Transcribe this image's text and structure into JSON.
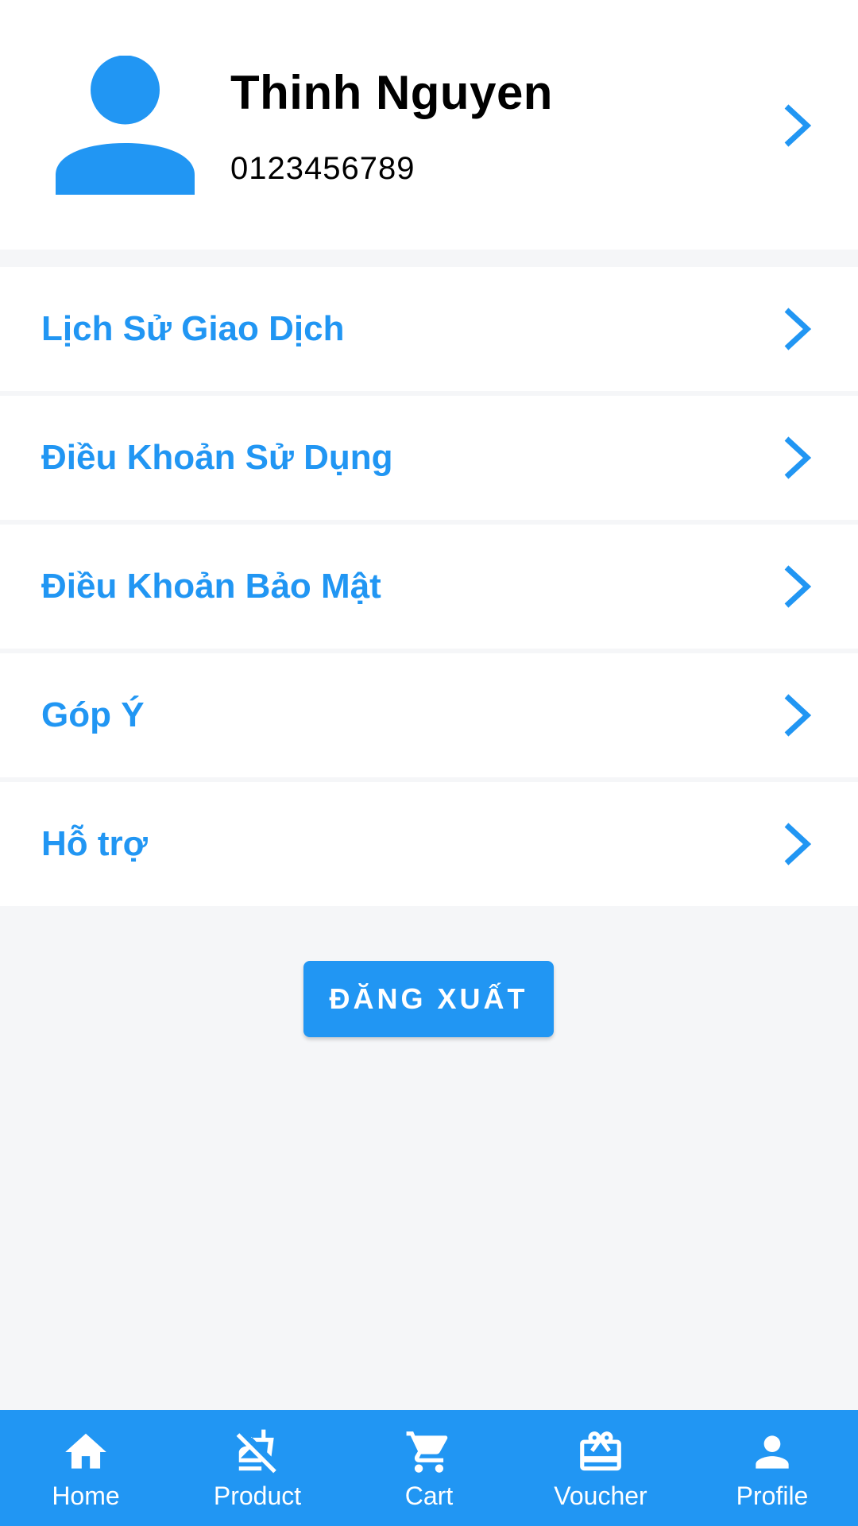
{
  "colors": {
    "accent": "#2196F3",
    "background": "#F5F6F8",
    "card": "#FFFFFF",
    "text": "#000000"
  },
  "profile": {
    "name": "Thinh Nguyen",
    "phone": "0123456789",
    "avatar_icon": "person-icon",
    "chevron_icon": "chevron-right-icon"
  },
  "menu": {
    "items": [
      {
        "label": "Lịch Sử Giao Dịch",
        "icon": "chevron-right-icon"
      },
      {
        "label": "Điều Khoản Sử Dụng",
        "icon": "chevron-right-icon"
      },
      {
        "label": "Điều Khoản Bảo Mật",
        "icon": "chevron-right-icon"
      },
      {
        "label": "Góp Ý",
        "icon": "chevron-right-icon"
      },
      {
        "label": "Hỗ trợ",
        "icon": "chevron-right-icon"
      }
    ]
  },
  "logout": {
    "label": "ĐĂNG XUẤT"
  },
  "bottom_nav": {
    "items": [
      {
        "label": "Home",
        "icon": "home-icon"
      },
      {
        "label": "Product",
        "icon": "no-food-icon"
      },
      {
        "label": "Cart",
        "icon": "cart-icon"
      },
      {
        "label": "Voucher",
        "icon": "voucher-icon"
      },
      {
        "label": "Profile",
        "icon": "person-icon"
      }
    ]
  }
}
